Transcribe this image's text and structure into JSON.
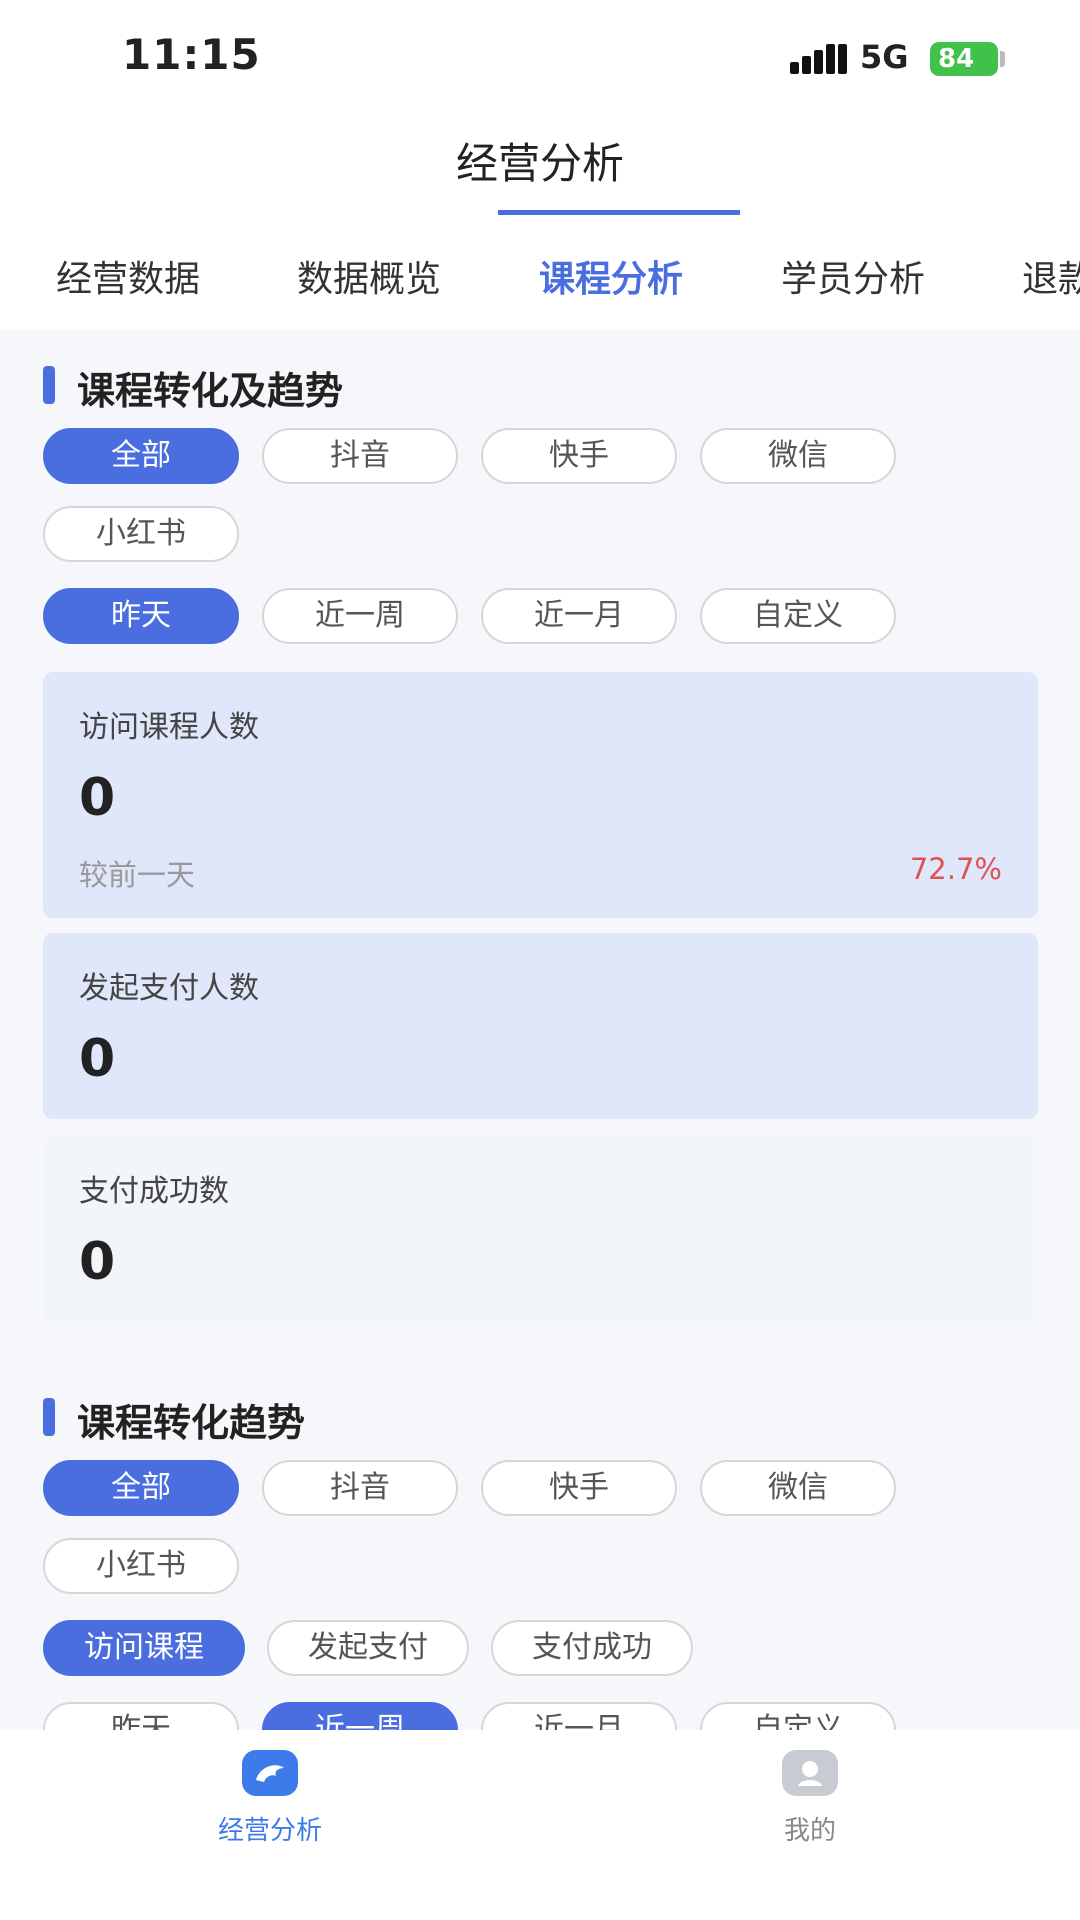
{
  "status_bar": {
    "time": "11:15",
    "network": "5G",
    "battery": "84"
  },
  "header": {
    "title": "经营分析",
    "tabs": [
      "经营数据",
      "数据概览",
      "课程分析",
      "学员分析",
      "退款"
    ],
    "active_tab": "课程分析"
  },
  "section1": {
    "title": "课程转化及趋势",
    "channels": [
      "全部",
      "抖音",
      "快手",
      "微信",
      "小红书"
    ],
    "periods": [
      "昨天",
      "近一周",
      "近一月",
      "自定义"
    ],
    "cards": [
      {
        "label": "访问课程人数",
        "value": "0",
        "compare_label": "较前一天",
        "compare_value": "72.7%"
      },
      {
        "label": "发起支付人数",
        "value": "0"
      },
      {
        "label": "支付成功数",
        "value": "0"
      }
    ]
  },
  "section2": {
    "title": "课程转化趋势",
    "channels": [
      "全部",
      "抖音",
      "快手",
      "微信",
      "小红书"
    ],
    "metrics": [
      "访问课程",
      "发起支付",
      "支付成功"
    ],
    "periods": [
      "昨天",
      "近一周",
      "近一月",
      "自定义"
    ]
  },
  "bottom_nav": [
    {
      "label": "经营分析",
      "icon": "dolphin-icon",
      "active": true
    },
    {
      "label": "我的",
      "icon": "profile-icon",
      "active": false
    }
  ],
  "colors": {
    "accent": "#4a6ee0",
    "up_pct": "#e05050",
    "card_bg": "#e0e7fb"
  }
}
